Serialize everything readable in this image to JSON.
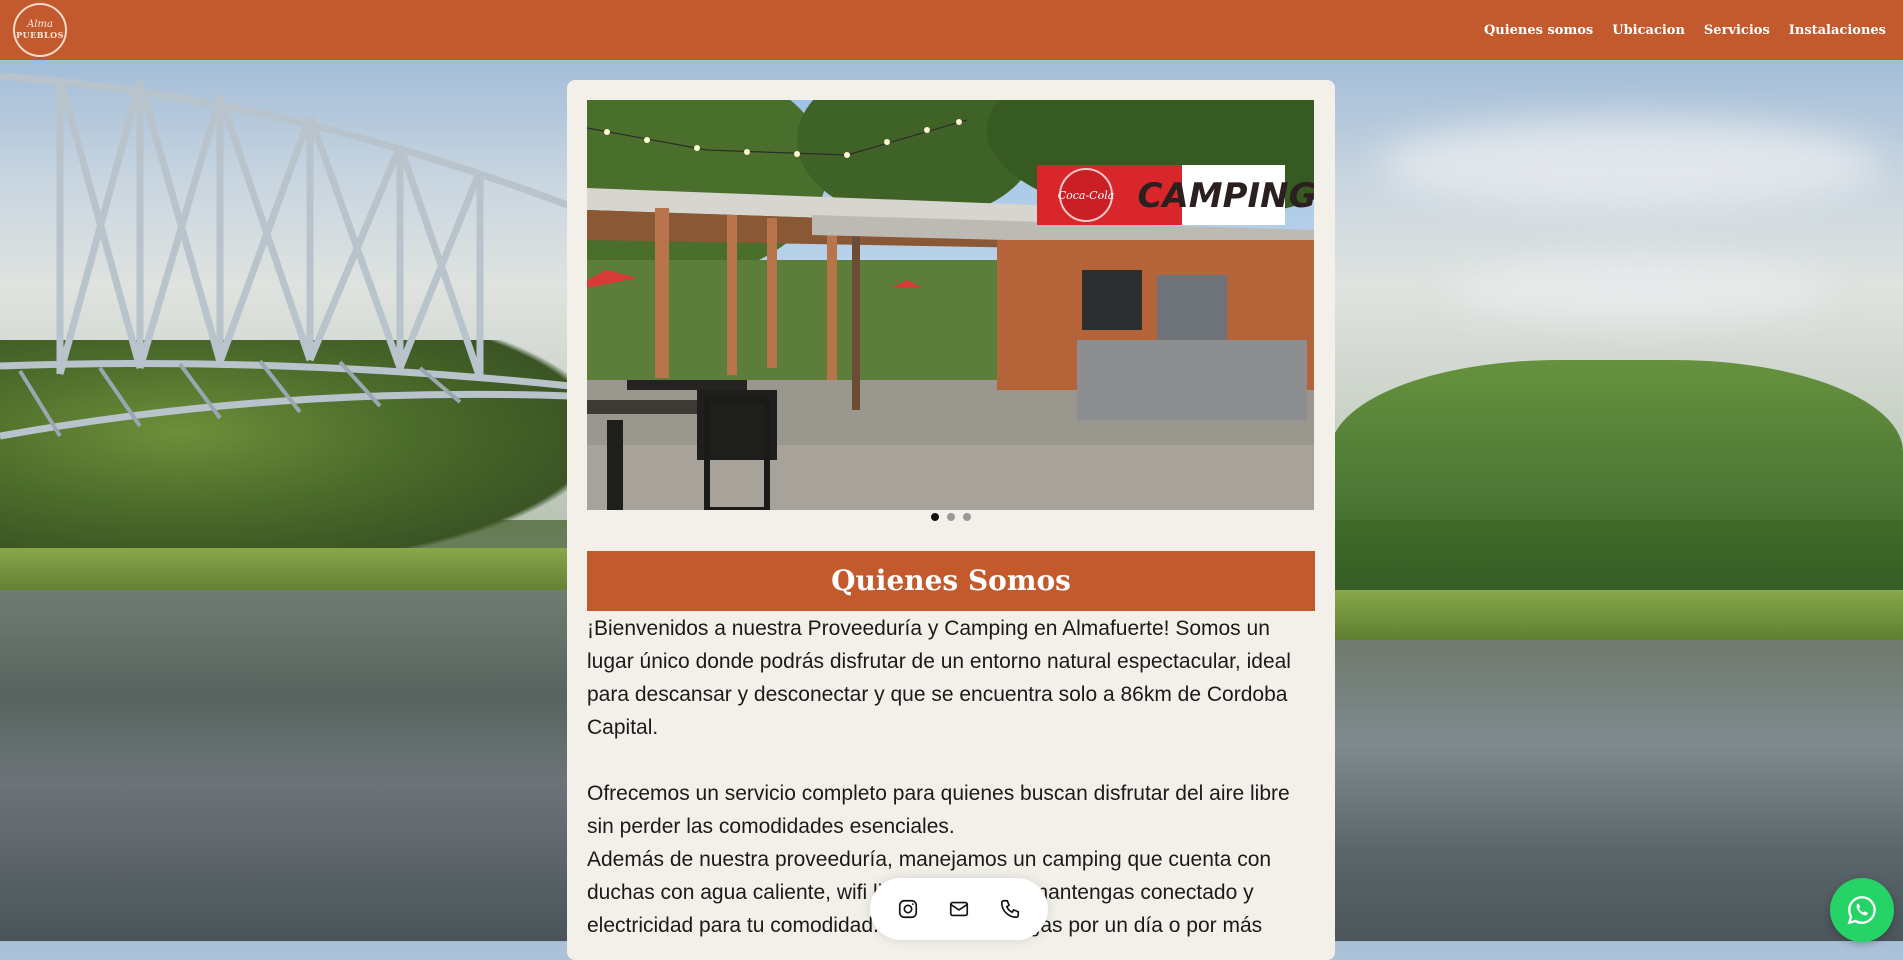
{
  "brand": {
    "logo_line1": "Alma",
    "logo_line2": "PUEBLOS"
  },
  "nav": {
    "items": [
      "Quienes somos",
      "Ubicacion",
      "Servicios",
      "Instalaciones"
    ]
  },
  "hero": {
    "sign_text": "CAMPING",
    "sign_brand": "Coca-Cola",
    "slide_count": 3,
    "active_slide": 1
  },
  "section": {
    "title": "Quienes Somos",
    "paragraph1": "¡Bienvenidos a nuestra Proveeduría y Camping en Almafuerte! Somos un lugar único donde podrás disfrutar de un entorno natural espectacular, ideal para descansar y desconectar y que se encuentra solo a 86km de Cordoba Capital.",
    "paragraph2": "Ofrecemos un servicio completo para quienes buscan disfrutar del aire libre sin perder las comodidades esenciales.",
    "paragraph3": "Además de nuestra proveeduría, manejamos un camping que cuenta con duchas con agua caliente, wifi libre para que te mantengas conectado y electricidad para tu comodidad. Ya sea que vengas por un día o por más"
  },
  "social": {
    "icons": [
      "instagram-icon",
      "mail-icon",
      "phone-icon"
    ]
  },
  "whatsapp": {
    "icon": "whatsapp-icon",
    "color": "#25d366"
  },
  "colors": {
    "brand": "#c25a2e",
    "card": "#f3f0ea"
  }
}
